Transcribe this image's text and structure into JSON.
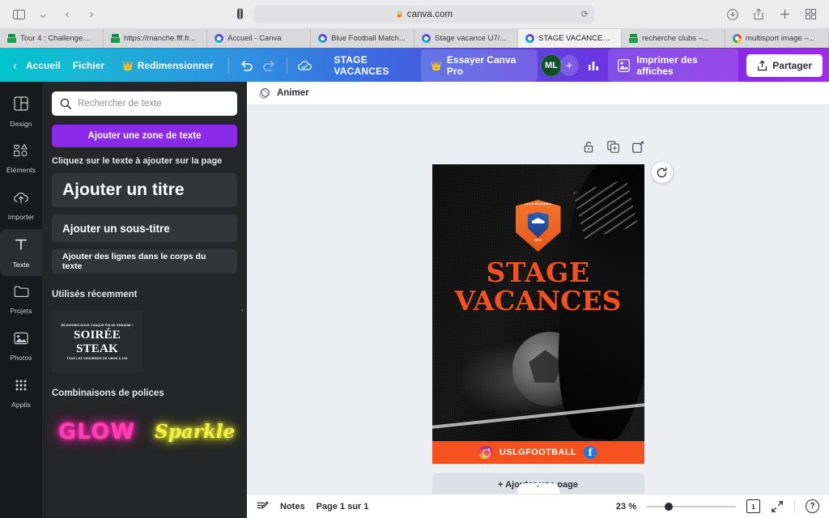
{
  "browser": {
    "url_host": "canva.com",
    "lock_icon": "lock-icon",
    "reload_icon": "reload-icon",
    "sidebar_icon": "sidebar-toggle-icon",
    "back_icon": "back-chevron-icon",
    "forward_icon": "forward-chevron-icon",
    "reader_icon": "reader-view-icon",
    "downloads_icon": "downloads-icon",
    "share_icon": "share-icon",
    "newtab_icon": "new-tab-icon",
    "tabs_overview_icon": "tab-overview-icon",
    "tabs": [
      {
        "title": "Tour 4 : Challenge...",
        "favicon": "fff-icon",
        "active": false
      },
      {
        "title": "https://manche.fff.fr...",
        "favicon": "fff-icon",
        "active": false
      },
      {
        "title": "Accueil - Canva",
        "favicon": "canva-icon",
        "active": false
      },
      {
        "title": "Blue Football Match...",
        "favicon": "canva-icon",
        "active": false
      },
      {
        "title": "Stage vacance U7/...",
        "favicon": "canva-icon",
        "active": false
      },
      {
        "title": "STAGE VACANCES...",
        "favicon": "canva-icon",
        "active": true
      },
      {
        "title": "recherche clubs –...",
        "favicon": "fff-icon",
        "active": false
      },
      {
        "title": "multisport image –...",
        "favicon": "google-icon",
        "active": false
      }
    ]
  },
  "toolbar": {
    "back_label": "Accueil",
    "file_label": "Fichier",
    "resize_label": "Redimensionner",
    "crown_icon": "crown-icon",
    "undo_icon": "undo-icon",
    "redo_icon": "redo-icon",
    "cloud_icon": "cloud-saved-icon",
    "doc_title": "STAGE VACANCES",
    "pro_label": "Essayer Canva Pro",
    "avatar_initials": "ML",
    "add_collaborator_icon": "plus-icon",
    "insights_icon": "insights-bar-chart-icon",
    "print_icon": "print-poster-icon",
    "print_label": "Imprimer des affiches",
    "share_icon": "share-upload-icon",
    "share_label": "Partager"
  },
  "rail": {
    "items": [
      {
        "label": "Design",
        "icon": "design-layout-icon",
        "active": false
      },
      {
        "label": "Éléments",
        "icon": "elements-shapes-icon",
        "active": false
      },
      {
        "label": "Importer",
        "icon": "upload-cloud-icon",
        "active": false
      },
      {
        "label": "Texte",
        "icon": "text-t-icon",
        "active": true
      },
      {
        "label": "Projets",
        "icon": "folder-icon",
        "active": false
      },
      {
        "label": "Photos",
        "icon": "photo-icon",
        "active": false
      },
      {
        "label": "Applis",
        "icon": "apps-grid-icon",
        "active": false
      }
    ]
  },
  "panel": {
    "search_placeholder": "Rechercher de texte",
    "search_value": "",
    "search_icon": "search-icon",
    "add_textbox_label": "Ajouter une zone de texte",
    "hint": "Cliquez sur le texte à ajouter sur la page",
    "presets": [
      {
        "label": "Ajouter un titre",
        "size": "title"
      },
      {
        "label": "Ajouter un sous-titre",
        "size": "subtitle"
      },
      {
        "label": "Ajouter des lignes dans le corps du texte",
        "size": "body"
      }
    ],
    "recent_heading": "Utilisés récemment",
    "recent_item": {
      "top_line": "REJOIGNEZ-NOUS CHAQUE FIN DE SEMAINE !",
      "title_line1": "SOIRÉE",
      "title_line2": "STEAK",
      "bottom_line": "TOUS LES VENDREDIS DE 18H30 À 22H"
    },
    "fonts_heading": "Combinaisons de polices",
    "font_samples": [
      {
        "label": "GLOW",
        "color": "#ff3fb4"
      },
      {
        "label": "Sparkle",
        "color": "#f2f24a"
      }
    ],
    "collapse_icon": "collapse-left-chevron-icon"
  },
  "canvas": {
    "animate_label": "Animer",
    "animate_icon": "animate-icon",
    "page_tools": [
      {
        "icon": "unlock-icon"
      },
      {
        "icon": "duplicate-page-icon"
      },
      {
        "icon": "add-page-icon"
      }
    ],
    "refresh_icon": "regenerate-icon",
    "add_page_label": "+ Ajouter une page",
    "scroll_collapse_icon": "chevron-up-icon",
    "poster": {
      "badge_top_text": "US LA GLACERIE",
      "badge_year": "1971",
      "title_line1": "STAGE",
      "title_line2": "VACANCES",
      "title_color": "#f4511e",
      "social_handle": "USLGFOOTBALL",
      "instagram_icon": "instagram-icon",
      "facebook_icon": "facebook-icon",
      "bar_color": "#f4511e"
    }
  },
  "statusbar": {
    "notes_icon": "notes-icon",
    "notes_label": "Notes",
    "page_indicator": "Page 1 sur 1",
    "zoom_label": "23 %",
    "page_count_value": "1",
    "page_count_icon": "page-count-icon",
    "fullscreen_icon": "fullscreen-icon",
    "help_icon": "help-icon"
  }
}
